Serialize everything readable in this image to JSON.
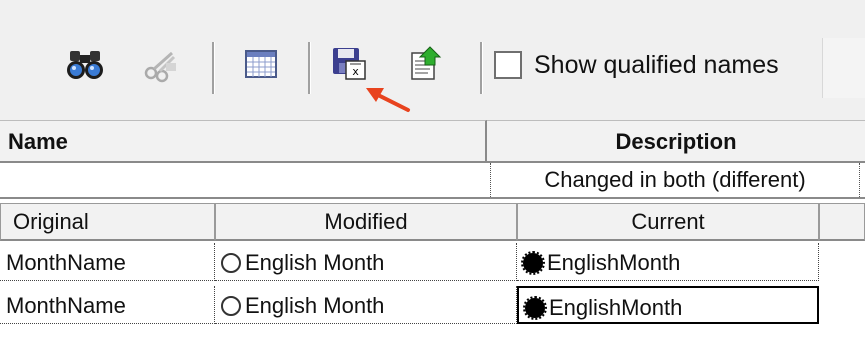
{
  "toolbar": {
    "buttons": [
      {
        "icon": "binoculars-icon"
      },
      {
        "icon": "prune-scissors-icon"
      },
      {
        "icon": "grid-table-icon"
      },
      {
        "icon": "save-excel-icon"
      },
      {
        "icon": "export-green-arrow-icon"
      }
    ],
    "show_qualified_names": {
      "label": "Show qualified names",
      "checked": false
    },
    "arrow_color": "#e8431e"
  },
  "grid": {
    "name_header": "Name",
    "description_header": "Description",
    "description_value": "Changed in both (different)",
    "columns": {
      "original": "Original",
      "modified": "Modified",
      "current": "Current"
    },
    "rows": [
      {
        "original": "MonthName",
        "modified": "English Month",
        "current": "EnglishMonth",
        "modified_selected": false,
        "current_selected": true
      },
      {
        "original": "MonthName",
        "modified": "English Month",
        "current": "EnglishMonth",
        "modified_selected": false,
        "current_selected": true
      }
    ]
  }
}
